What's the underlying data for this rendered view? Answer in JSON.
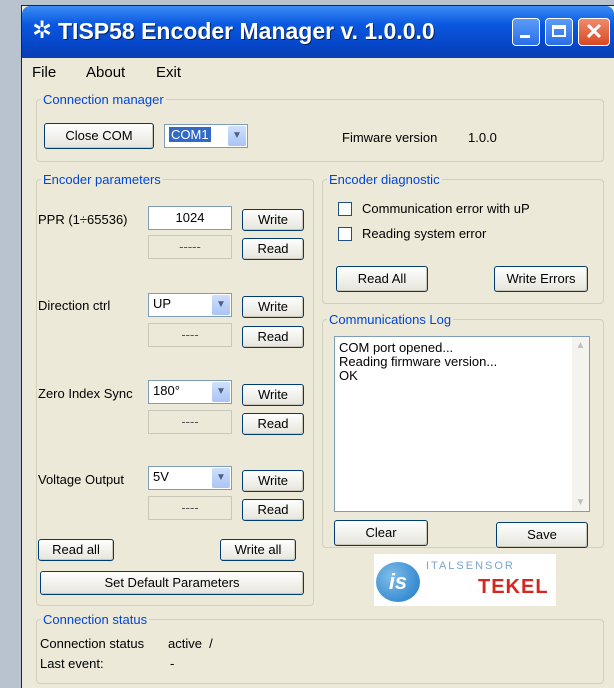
{
  "window": {
    "title": "TISP58 Encoder Manager v. 1.0.0.0",
    "icon": "gear-icon"
  },
  "menu": [
    "File",
    "About",
    "Exit"
  ],
  "connection_manager": {
    "legend": "Connection manager",
    "close_com_label": "Close COM",
    "com_port": "COM1",
    "firmware_label": "Fimware version",
    "firmware_value": "1.0.0"
  },
  "encoder_parameters": {
    "legend": "Encoder parameters",
    "ppr": {
      "label": "PPR (1÷65536)",
      "value": "1024",
      "readback": "-----",
      "write_label": "Write",
      "read_label": "Read"
    },
    "direction": {
      "label": "Direction ctrl",
      "value": "UP",
      "readback": "----",
      "write_label": "Write",
      "read_label": "Read"
    },
    "zero_index": {
      "label": "Zero Index Sync",
      "value": "180°",
      "readback": "----",
      "write_label": "Write",
      "read_label": "Read"
    },
    "voltage": {
      "label": "Voltage Output",
      "value": "5V",
      "readback": "----",
      "write_label": "Write",
      "read_label": "Read"
    },
    "read_all_label": "Read all",
    "write_all_label": "Write all",
    "defaults_label": "Set Default Parameters"
  },
  "encoder_diagnostic": {
    "legend": "Encoder diagnostic",
    "errors": [
      "Communication error with uP",
      "Reading system error"
    ],
    "read_all_label": "Read All",
    "write_errors_label": "Write Errors"
  },
  "communications_log": {
    "legend": "Communications Log",
    "lines": [
      "COM port opened...",
      "Reading firmware version...",
      "OK"
    ],
    "clear_label": "Clear",
    "save_label": "Save"
  },
  "logo": {
    "brand": "ITALSENSOR",
    "sub": "TEKEL",
    "mark": "is"
  },
  "connection_status": {
    "legend": "Connection status",
    "status_label": "Connection status",
    "status_value": "active  /",
    "last_event_label": "Last event:",
    "last_event_value": "-"
  }
}
